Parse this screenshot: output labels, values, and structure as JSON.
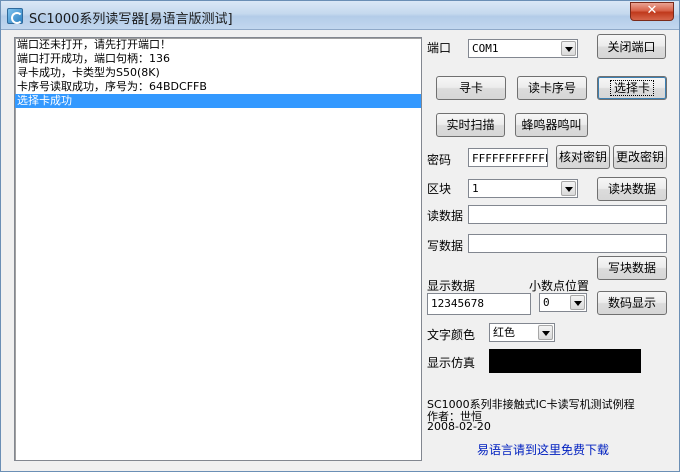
{
  "window": {
    "title": "SC1000系列读写器[易语言版测试]",
    "close_symbol": "✕"
  },
  "log": {
    "lines": [
      "端口还未打开，请先打开端口！",
      "端口打开成功，端口句柄：136",
      "寻卡成功，卡类型为S50(8K)",
      "卡序号读取成功，序号为：64BDCFFB",
      "选择卡成功"
    ],
    "selected_index": 4
  },
  "port": {
    "label": "端口",
    "value": "COM1",
    "close_button": "关闭端口"
  },
  "buttons": {
    "find_card": "寻卡",
    "read_serial": "读卡序号",
    "select_card": "选择卡",
    "realtime_scan": "实时扫描",
    "beep": "蜂鸣器鸣叫",
    "verify_password": "核对密钥",
    "change_password": "更改密钥",
    "read_block": "读块数据",
    "write_block": "写块数据",
    "digit_display": "数码显示"
  },
  "password": {
    "label": "密码",
    "value": "FFFFFFFFFFFF"
  },
  "block": {
    "label": "区块",
    "value": "1"
  },
  "read_data": {
    "label": "读数据",
    "value": ""
  },
  "write_data": {
    "label": "写数据",
    "value": ""
  },
  "display_data": {
    "label": "显示数据",
    "value": "12345678"
  },
  "decimal_point": {
    "label": "小数点位置",
    "value": "0"
  },
  "text_color": {
    "label": "文字颜色",
    "value": "红色"
  },
  "simulation": {
    "label": "显示仿真",
    "background": "#000000"
  },
  "footer": {
    "line1": "SC1000系列非接触式IC卡读写机测试例程",
    "line2": "作者：世恒",
    "line3": "2008-02-20",
    "link": "易语言请到这里免费下载"
  }
}
